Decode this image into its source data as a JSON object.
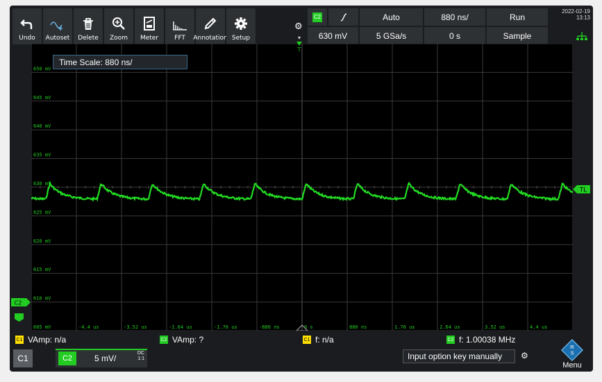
{
  "toolbar": {
    "undo": "Undo",
    "autoset": "Autoset",
    "delete": "Delete",
    "zoom": "Zoom",
    "meter": "Meter",
    "fft": "FFT",
    "annotation": "Annotation",
    "setup": "Setup"
  },
  "status": {
    "trigger_channel": "C2",
    "trigger_slope_icon": "rising-edge-icon",
    "trigger_mode": "Auto",
    "timebase": "880 ns/",
    "run_state": "Run",
    "trigger_level": "630 mV",
    "sample_rate": "5 GSa/s",
    "horizontal_position": "0 s",
    "acquisition_mode": "Sample"
  },
  "datetime": {
    "date": "2022-02-19",
    "time": "13:13"
  },
  "tooltip": "Time Scale: 880 ns/",
  "y_labels": [
    "650 mV",
    "645 mV",
    "640 mV",
    "635 mV",
    "630 mV",
    "625 mV",
    "620 mV",
    "615 mV",
    "610 mV",
    "605 mV"
  ],
  "x_labels": [
    "-4.4 us",
    "-3.52 us",
    "-2.64 us",
    "-1.76 us",
    "-880 ns",
    "0 s",
    "880 ns",
    "1.76 us",
    "2.64 us",
    "3.52 us",
    "4.4 us"
  ],
  "markers": {
    "trigger_level": "TL",
    "channel2": "C2",
    "trigger_position": "T"
  },
  "measurements": [
    {
      "badge": "C1",
      "text": "VAmp: n/a",
      "color": "#ffe000"
    },
    {
      "badge": "C2",
      "text": "VAmp: ?",
      "color": "#22cc22"
    },
    {
      "badge": "C1",
      "text": "f: n/a",
      "color": "#ffe000"
    },
    {
      "badge": "C2",
      "text": "f: 1.00038 MHz",
      "color": "#22cc22"
    }
  ],
  "channels": {
    "c1_label": "C1",
    "c2_label": "C2",
    "c2_scale": "5 mV/",
    "c2_coupling": "DC",
    "c2_probe": "1:1"
  },
  "input_option": "Input option key manually",
  "menu_label": "Menu",
  "waveform": {
    "period": 1.00038,
    "color": "#22dd22"
  }
}
